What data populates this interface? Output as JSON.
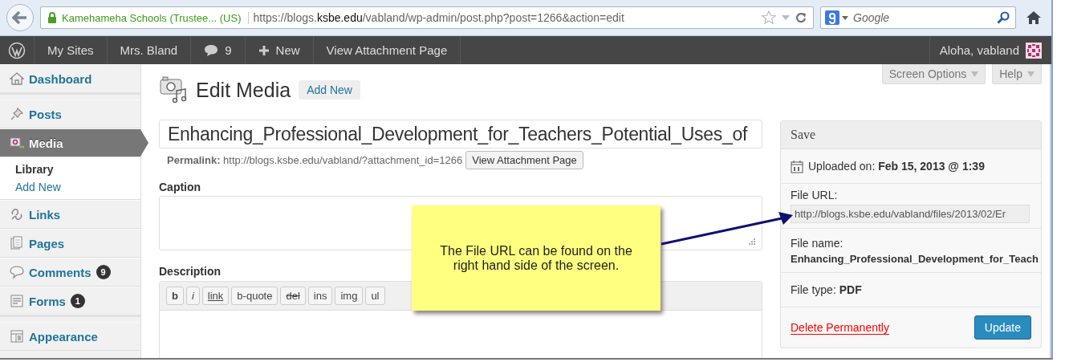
{
  "browser": {
    "site_identity": "Kamehameha Schools (Trustee... (US)",
    "url": {
      "prefix": "https://blogs.",
      "domain": "ksbe.edu",
      "path": "/vabland/wp-admin/post.php?post=1266&action=edit"
    },
    "search": {
      "placeholder": "Google"
    }
  },
  "admin_bar": {
    "items": [
      {
        "kind": "logo"
      },
      {
        "kind": "text",
        "label": "My Sites"
      },
      {
        "kind": "text",
        "label": "Mrs. Bland"
      },
      {
        "kind": "comments",
        "label": "9"
      },
      {
        "kind": "new",
        "label": "New"
      },
      {
        "kind": "text",
        "label": "View Attachment Page"
      }
    ],
    "greeting": "Aloha, vabland"
  },
  "sidebar": {
    "items": [
      {
        "label": "Dashboard",
        "selected": false
      },
      {
        "label": "Posts",
        "selected": false
      },
      {
        "label": "Media",
        "selected": true,
        "children": [
          {
            "label": "Library",
            "selected": true
          },
          {
            "label": "Add New",
            "selected": false
          }
        ]
      },
      {
        "label": "Links",
        "selected": false
      },
      {
        "label": "Pages",
        "selected": false
      },
      {
        "label": "Comments",
        "selected": false,
        "badge": "9"
      },
      {
        "label": "Forms",
        "selected": false,
        "badge": "1"
      },
      {
        "label": "Appearance",
        "selected": false
      }
    ]
  },
  "header": {
    "screen_options": "Screen Options",
    "help": "Help",
    "title": "Edit Media",
    "add_new": "Add New"
  },
  "title_field": {
    "value": "Enhancing_Professional_Development_for_Teachers_Potential_Uses_of"
  },
  "permalink": {
    "label": "Permalink:",
    "url": "http://blogs.ksbe.edu/vabland/?attachment_id=1266",
    "button": "View Attachment Page"
  },
  "caption": {
    "label": "Caption"
  },
  "description": {
    "label": "Description",
    "toolbar": [
      {
        "label": "b",
        "kind": "bold"
      },
      {
        "label": "i",
        "kind": "italic"
      },
      {
        "label": "link",
        "kind": "underline"
      },
      {
        "label": "b-quote",
        "kind": "plain"
      },
      {
        "label": "del",
        "kind": "strike"
      },
      {
        "label": "ins",
        "kind": "plain"
      },
      {
        "label": "img",
        "kind": "plain"
      },
      {
        "label": "ul",
        "kind": "plain"
      }
    ]
  },
  "save_box": {
    "title": "Save",
    "uploaded_label": "Uploaded on:",
    "uploaded_value": "Feb 15, 2013 @ 1:39",
    "file_url_label": "File URL:",
    "file_url": "http://blogs.ksbe.edu/vabland/files/2013/02/Er",
    "file_name_label": "File name:",
    "file_name": "Enhancing_Professional_Development_for_Teach",
    "file_type_label": "File type:",
    "file_type": "PDF",
    "delete": "Delete Permanently",
    "update": "Update"
  },
  "callout": {
    "text": "The File URL can be found on the right hand side of the screen."
  }
}
